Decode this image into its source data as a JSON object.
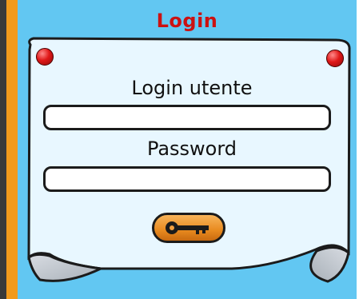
{
  "panel": {
    "title": "Login"
  },
  "form": {
    "username_label": "Login utente",
    "username_value": "",
    "password_label": "Password",
    "password_value": "",
    "submit_icon": "key-icon"
  },
  "colors": {
    "title": "#cc1111",
    "panel_background": "#62c7f2",
    "paper": "#e8f7ff",
    "left_accent": "#f29a1c",
    "button": "#e88a1f"
  }
}
